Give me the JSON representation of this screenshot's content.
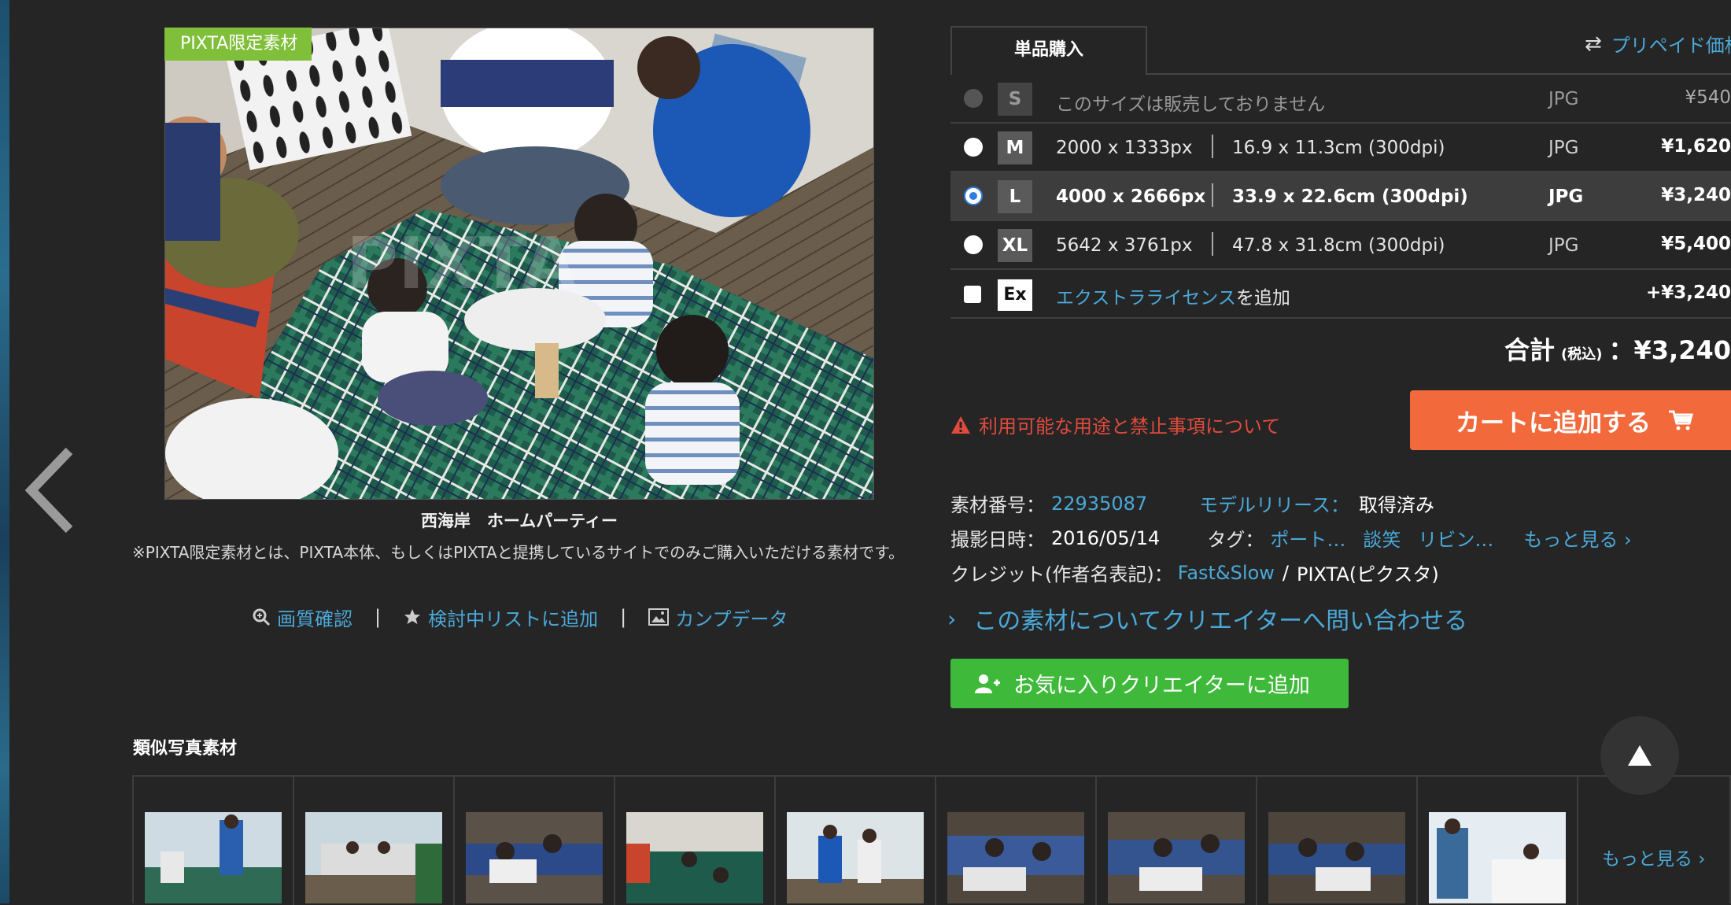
{
  "photo": {
    "badge": "PIXTA限定素材",
    "title": "西海岸　ホームパーティー",
    "note": "※PIXTA限定素材とは、PIXTA本体、もしくはPIXTAと提携しているサイトでのみご購入いただける素材です。"
  },
  "tools": {
    "quality": "画質確認",
    "list": "検討中リストに追加",
    "comp": "カンプデータ",
    "sep": "|"
  },
  "purchase": {
    "tab": "単品購入",
    "prepaid_link": "プリペイド価格",
    "sizes": [
      {
        "code": "S",
        "unavailable": "このサイズは販売しておりません",
        "format": "JPG",
        "price": "¥540"
      },
      {
        "code": "M",
        "px": "2000 x 1333px",
        "cm": "16.9 x 11.3cm (300dpi)",
        "format": "JPG",
        "price": "¥1,620"
      },
      {
        "code": "L",
        "px": "4000 x 2666px",
        "cm": "33.9 x 22.6cm (300dpi)",
        "format": "JPG",
        "price": "¥3,240"
      },
      {
        "code": "XL",
        "px": "5642 x 3761px",
        "cm": "47.8 x 31.8cm (300dpi)",
        "format": "JPG",
        "price": "¥5,400"
      }
    ],
    "extra": {
      "code": "Ex",
      "link": "エクストラライセンス",
      "suffix": "を追加",
      "price": "+¥3,240"
    },
    "total_label": "合計",
    "total_tax": "(税込)",
    "total_value": "：¥3,240",
    "warning": "利用可能な用途と禁止事項について",
    "cart_button": "カートに追加する"
  },
  "meta": {
    "number_label": "素材番号：",
    "number_value": "22935087",
    "model_label": "モデルリリース：",
    "model_value": "取得済み",
    "date_label": "撮影日時：",
    "date_value": "2016/05/14",
    "tag_label": "タグ：",
    "tags": [
      "ポート…",
      "談笑",
      "リビン…"
    ],
    "more_tags": "もっと見る ›",
    "credit_label": "クレジット(作者名表記)：",
    "credit_author": "Fast&Slow",
    "credit_sep": "/",
    "credit_site": "PIXTA(ピクスタ)"
  },
  "inquiry": "この素材についてクリエイターへ問い合わせる",
  "fav_button": "お気に入りクリエイターに追加",
  "similar": {
    "title": "類似写真素材",
    "more": "もっと見る ›"
  }
}
